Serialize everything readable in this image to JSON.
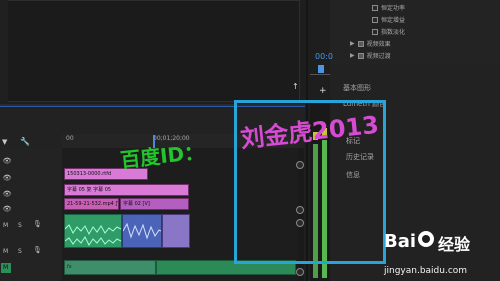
{
  "effects_tree": [
    {
      "label": "恒定功率",
      "type": "checkbox"
    },
    {
      "label": "恒定增益",
      "type": "checkbox"
    },
    {
      "label": "指数淡化",
      "type": "checkbox"
    },
    {
      "label": "视频效果",
      "type": "folder"
    },
    {
      "label": "视频过渡",
      "type": "folder"
    }
  ],
  "timecode": "00:0",
  "right_panel_items": [
    "基本图形",
    "Lumetri 颜色",
    "标记",
    "历史记录",
    "信息"
  ],
  "timeline": {
    "ruler_start": "00",
    "ruler_mid": "00;01;20;00",
    "clips": {
      "v3_label": "150313-0000.rtfd",
      "v2_label": "字幕 05 复 字幕 05",
      "v1_label": "21-59-21-532.mp4 [V]",
      "v1_label2": "字幕 02 [V]",
      "a2_label": "fx",
      "a1_label": "fx"
    },
    "track_letters": [
      "M",
      "S",
      "M",
      "S",
      "M"
    ]
  },
  "watermark": {
    "text_left": "百度ID：",
    "text_right": "刘金虎2013",
    "text_right_color": "#d54bd1",
    "text_left_color": "#22c52b",
    "frame_color": "#27a4d8"
  },
  "baidu": {
    "logo_part1": "Bai",
    "logo_part2": "经验",
    "url": "jingyan.baidu.com"
  },
  "colors": {
    "clip_pink": "#d87ad6",
    "clip_green": "#2f9b67",
    "clip_blue": "#4b64b8",
    "clip_violet": "#8a76c6",
    "clip_teal": "#3f8e6b",
    "meter_green": "#57b84f"
  }
}
